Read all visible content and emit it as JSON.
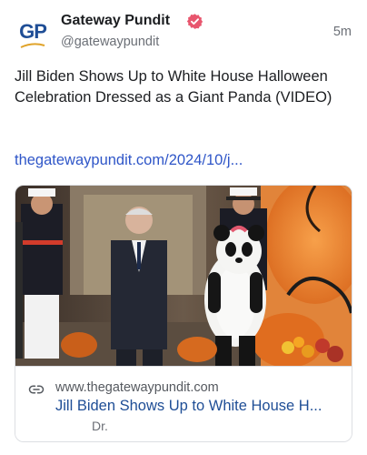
{
  "post": {
    "author": {
      "name": "Gateway Pundit",
      "handle": "@gatewaypundit",
      "avatar_text": "GP",
      "verified": true,
      "verified_color": "#e8566e"
    },
    "time": "5m",
    "text": "Jill Biden Shows Up to White House Halloween Celebration Dressed as a Giant Panda (VIDEO)",
    "link_text": "thegatewaypundit.com/2024/10/j...",
    "link_color": "#2f56c8",
    "card": {
      "domain": "www.thegatewaypundit.com",
      "title": "Jill Biden Shows Up to White House H...",
      "subtitle": "Dr.",
      "title_color": "#1f4e96",
      "image_description_icon": "photo-thumbnail"
    }
  }
}
